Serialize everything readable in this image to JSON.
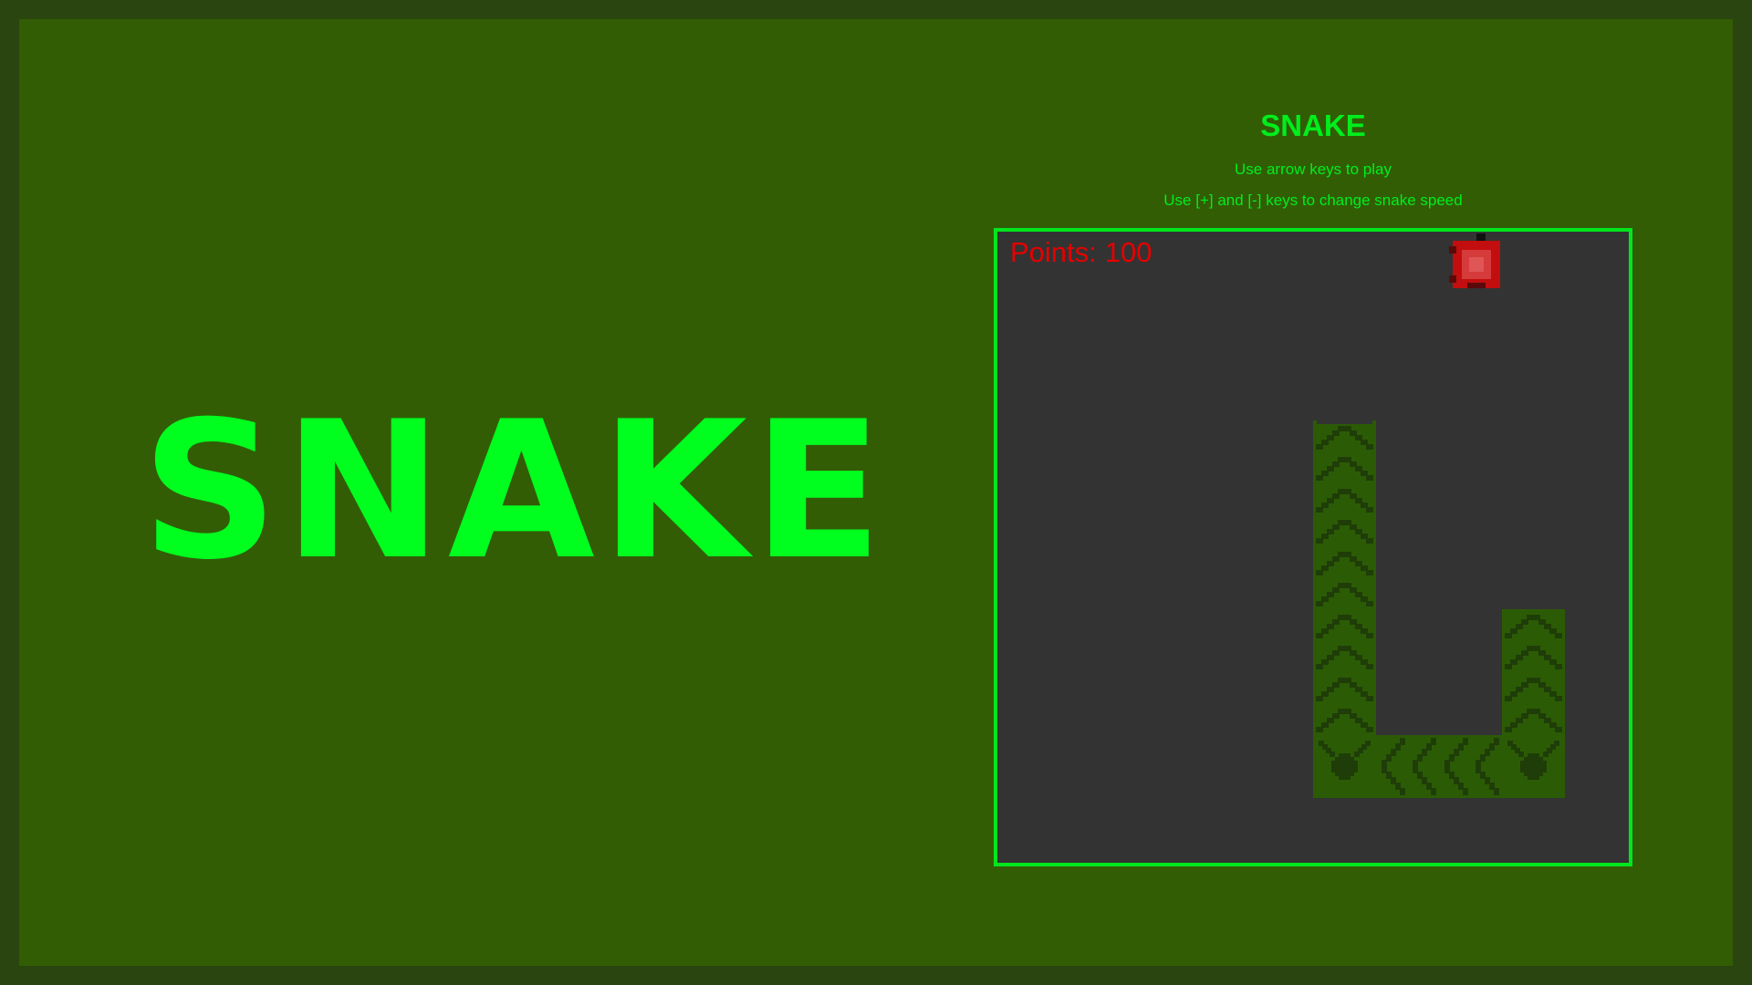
{
  "banner": {
    "title": "SNAKE"
  },
  "header": {
    "title": "SNAKE",
    "instruction_move": "Use arrow keys to play",
    "instruction_speed": "Use [+] and [-] keys to change snake speed"
  },
  "hud": {
    "points_label": "Points:",
    "points_value": "100"
  },
  "colors": {
    "page_border": "#2a4510",
    "background": "#325d05",
    "accent_green": "#00ff1e",
    "board_bg": "#333333",
    "board_border": "#00e61c",
    "points_text": "#e60000",
    "snake_body": "#2b5c05",
    "snake_pattern": "#1f3d08",
    "food_red": "#c20e0e"
  },
  "icons": {
    "food": "apple-icon",
    "snake": "snake-segment-icon"
  },
  "game": {
    "grid_columns": 10,
    "grid_rows": 10,
    "food": {
      "col": 7,
      "row": 0
    },
    "snake": [
      {
        "col": 5,
        "row": 3,
        "kind": "tail"
      },
      {
        "col": 5,
        "row": 4,
        "kind": "body-vertical"
      },
      {
        "col": 5,
        "row": 5,
        "kind": "body-vertical"
      },
      {
        "col": 5,
        "row": 6,
        "kind": "body-vertical"
      },
      {
        "col": 5,
        "row": 7,
        "kind": "body-vertical"
      },
      {
        "col": 5,
        "row": 8,
        "kind": "corner"
      },
      {
        "col": 6,
        "row": 8,
        "kind": "body-horizontal"
      },
      {
        "col": 7,
        "row": 8,
        "kind": "body-horizontal"
      },
      {
        "col": 8,
        "row": 8,
        "kind": "corner"
      },
      {
        "col": 8,
        "row": 7,
        "kind": "body-vertical"
      },
      {
        "col": 8,
        "row": 6,
        "kind": "head"
      }
    ]
  }
}
